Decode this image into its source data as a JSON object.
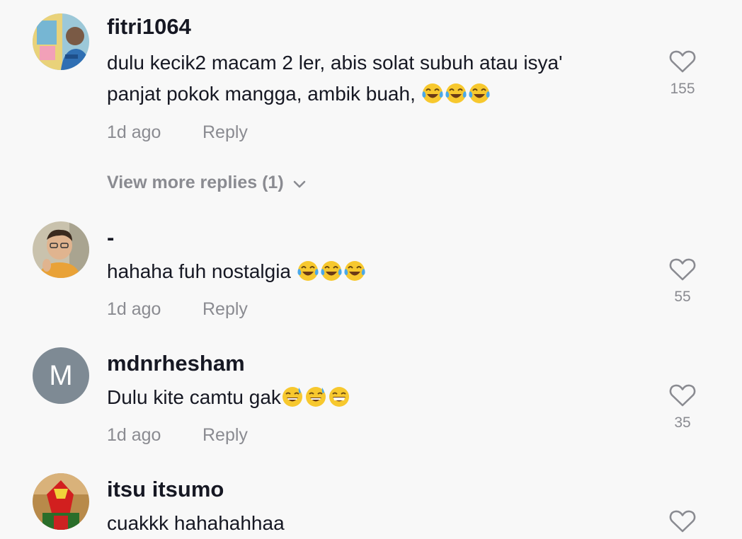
{
  "comments": [
    {
      "username": "fitri1064",
      "text_line1": "dulu kecik2 macam 2 ler, abis solat subuh atau isya'",
      "text_line2": "panjat pokok mangga, ambik buah, ",
      "emojis": [
        "😂",
        "😂",
        "😂"
      ],
      "time": "1d ago",
      "reply": "Reply",
      "likes": "155"
    },
    {
      "username": "-",
      "text": "hahaha fuh nostalgia ",
      "emojis": [
        "😂",
        "😂",
        "😂"
      ],
      "time": "1d ago",
      "reply": "Reply",
      "likes": "55"
    },
    {
      "username": "mdnrhesham",
      "avatar_letter": "M",
      "text": "Dulu kite camtu gak",
      "emojis": [
        "😅",
        "😅",
        "😁"
      ],
      "time": "1d ago",
      "reply": "Reply",
      "likes": "35"
    },
    {
      "username": "itsu itsumo",
      "text": "cuakkk hahahahhaa"
    }
  ],
  "view_more": "View more replies (1)",
  "colors": {
    "background": "#f8f8f8",
    "primary_text": "#161823",
    "secondary_text": "#8a8b91",
    "avatar_letter_bg": "#7e8a94"
  },
  "icons": {
    "like": "heart-outline-icon",
    "expand": "chevron-down-icon"
  }
}
